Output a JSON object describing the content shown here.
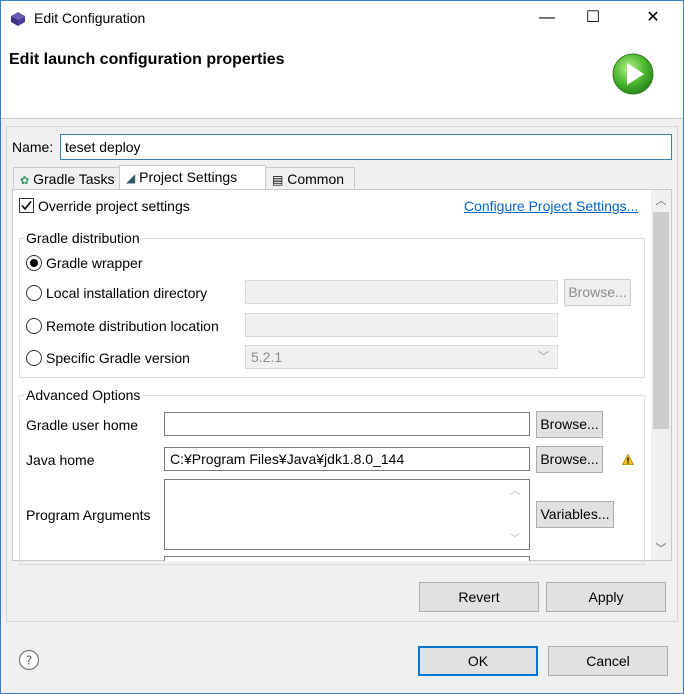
{
  "window": {
    "title": "Edit Configuration",
    "minimize": "—",
    "maximize": "☐",
    "close": "✕"
  },
  "header": {
    "title": "Edit launch configuration properties"
  },
  "name": {
    "label": "Name:",
    "value": "teset deploy"
  },
  "tabs": [
    {
      "label": "Gradle Tasks",
      "icon": "gear-icon"
    },
    {
      "label": "Project Settings",
      "icon": "elephant-icon"
    },
    {
      "label": "Common",
      "icon": "window-icon"
    }
  ],
  "override": {
    "label": "Override project settings",
    "checked": true
  },
  "configure_link": "Configure Project Settings...",
  "gradle_distribution": {
    "title": "Gradle distribution",
    "options": [
      {
        "label": "Gradle wrapper",
        "selected": true
      },
      {
        "label": "Local installation directory",
        "selected": false
      },
      {
        "label": "Remote distribution location",
        "selected": false
      },
      {
        "label": "Specific Gradle version",
        "selected": false
      }
    ],
    "browse": "Browse...",
    "version": "5.2.1"
  },
  "advanced": {
    "title": "Advanced Options",
    "user_home_label": "Gradle user home",
    "user_home_value": "",
    "java_home_label": "Java home",
    "java_home_value": "C:¥Program Files¥Java¥jdk1.8.0_144",
    "program_args_label": "Program Arguments",
    "browse": "Browse...",
    "variables": "Variables..."
  },
  "buttons": {
    "revert": "Revert",
    "apply": "Apply",
    "ok": "OK",
    "cancel": "Cancel"
  }
}
